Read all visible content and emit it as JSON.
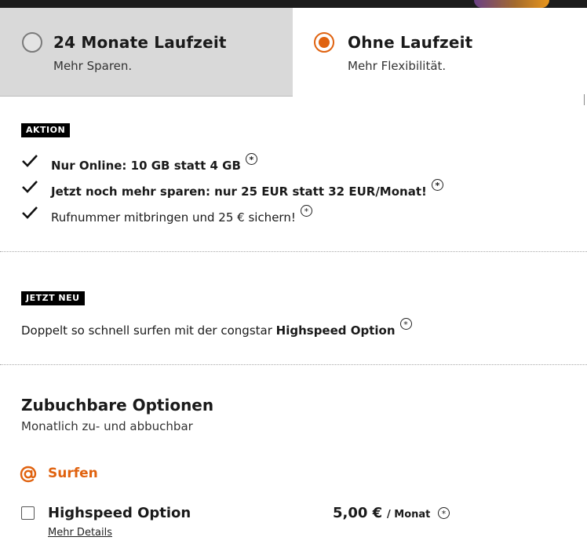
{
  "plan_selector": {
    "options": [
      {
        "title": "24 Monate Laufzeit",
        "subtitle": "Mehr Sparen.",
        "selected": false
      },
      {
        "title": "Ohne Laufzeit",
        "subtitle": "Mehr Flexibilität.",
        "selected": true
      }
    ]
  },
  "promo": {
    "badge": "AKTION",
    "items": [
      {
        "text": "Nur Online: 10 GB statt 4 GB",
        "bold": true
      },
      {
        "text": "Jetzt noch mehr sparen: nur 25 EUR statt 32 EUR/Monat!",
        "bold": true
      },
      {
        "text": "Rufnummer mitbringen und 25 € sichern!",
        "bold": false
      }
    ]
  },
  "news": {
    "badge": "JETZT NEU",
    "text_prefix": "Doppelt so schnell surfen mit der congstar ",
    "text_bold": "Highspeed Option"
  },
  "options_section": {
    "heading": "Zubuchbare Optionen",
    "subheading": "Monatlich zu- und abbuchbar",
    "category": {
      "label": "Surfen",
      "icon": "at-sign-icon"
    },
    "items": [
      {
        "name": "Highspeed Option",
        "price": "5,00 €",
        "unit": "/ Monat",
        "details_link": "Mehr Details",
        "checked": false
      }
    ]
  },
  "footnote_marker": "*",
  "colors": {
    "accent": "#e0620f",
    "badge_bg": "#000000",
    "inactive_tab_bg": "#d9d9d9"
  }
}
